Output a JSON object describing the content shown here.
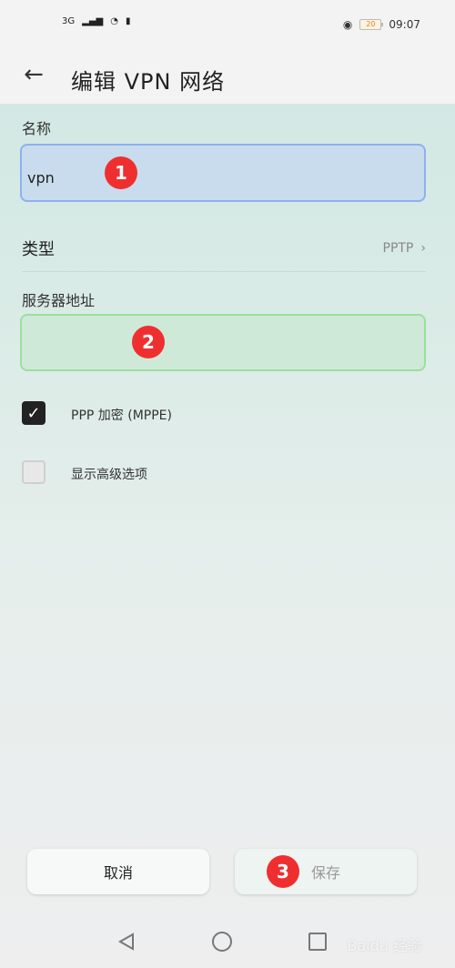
{
  "status": {
    "network": "3G",
    "battery": "20",
    "time": "09:07"
  },
  "header": {
    "title": "编辑 VPN 网络"
  },
  "form": {
    "name_label": "名称",
    "name_value": "vpn",
    "type_label": "类型",
    "type_value": "PPTP",
    "server_label": "服务器地址",
    "server_value": ""
  },
  "options": {
    "ppp_encryption": "PPP 加密 (MPPE)",
    "show_advanced": "显示高级选项"
  },
  "buttons": {
    "cancel": "取消",
    "save": "保存"
  },
  "badges": {
    "one": "1",
    "two": "2",
    "three": "3"
  },
  "watermark": "Baidu 经验",
  "icons": {
    "back": "back-arrow-icon",
    "signal": "signal-icon",
    "wifi": "wifi-icon",
    "battery": "battery-icon",
    "eye": "eye-icon",
    "chevron": "chevron-right-icon"
  }
}
